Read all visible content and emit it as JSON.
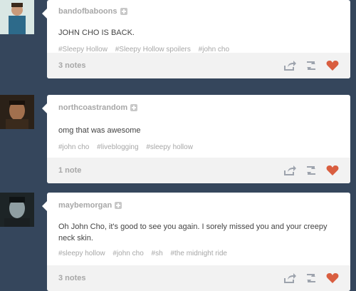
{
  "posts": [
    {
      "username": "bandofbaboons",
      "text": "JOHN CHO IS BACK.",
      "tags": [
        "#Sleepy Hollow",
        "#Sleepy Hollow spoilers",
        "#john cho"
      ],
      "notes": "3 notes",
      "avatar_colors": {
        "bg": "#d9e7e4",
        "skin": "#c99a7a",
        "shirt": "#2d6a8a"
      }
    },
    {
      "username": "northcoastrandom",
      "text": "omg that was awesome",
      "tags": [
        "#john cho",
        "#liveblogging",
        "#sleepy hollow"
      ],
      "notes": "1 note",
      "avatar_colors": {
        "bg": "#2b2118",
        "skin": "#a2704e",
        "shirt": "#3a2a1c"
      }
    },
    {
      "username": "maybemorgan",
      "text": "Oh John Cho, it's good to see you again. I sorely missed you and your creepy neck skin.",
      "tags": [
        "#sleepy hollow",
        "#john cho",
        "#sh",
        "#the midnight ride"
      ],
      "notes": "3 notes",
      "avatar_colors": {
        "bg": "#1d2426",
        "skin": "#8f9ea2",
        "shirt": "#1a1f21"
      }
    }
  ],
  "icons": {
    "share": "share-icon",
    "reblog": "reblog-icon",
    "like": "heart-icon"
  },
  "colors": {
    "background": "#35465c",
    "heart": "#d95e40",
    "footer": "#f2f2f2"
  }
}
